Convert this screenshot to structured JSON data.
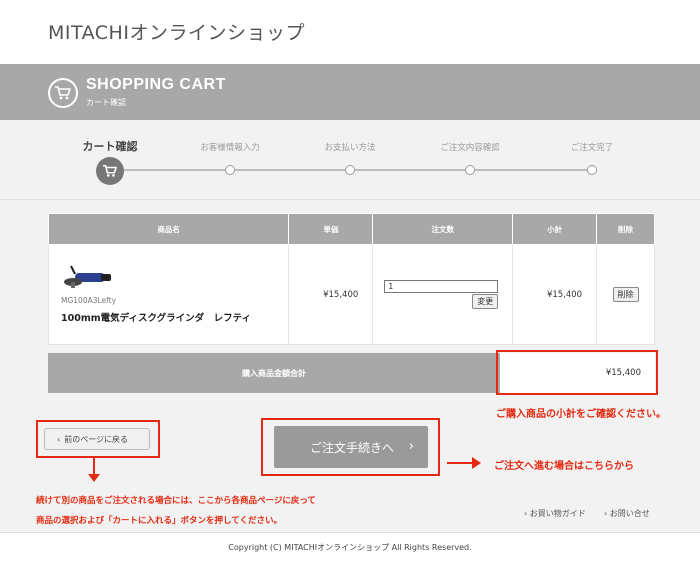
{
  "site": {
    "title": "MITACHIオンラインショップ"
  },
  "cart_header": {
    "title": "SHOPPING CART",
    "subtitle": "カート確認",
    "icon": "shopping-cart-icon"
  },
  "steps": [
    {
      "label": "カート確認",
      "active": true
    },
    {
      "label": "お客様情報入力",
      "active": false
    },
    {
      "label": "お支払い方法",
      "active": false
    },
    {
      "label": "ご注文内容確認",
      "active": false
    },
    {
      "label": "ご注文完了",
      "active": false
    }
  ],
  "table": {
    "headers": {
      "product": "商品名",
      "unit_price": "単価",
      "quantity": "注文数",
      "subtotal": "小計",
      "delete": "削除"
    },
    "rows": [
      {
        "code": "MG100A3Lefty",
        "name": "100mm電気ディスクグラインダ　レフティ",
        "unit_price": "¥15,400",
        "quantity": "1",
        "update_label": "変更",
        "subtotal": "¥15,400",
        "delete_label": "削除"
      }
    ]
  },
  "total": {
    "label": "購入商品金額合計",
    "value": "¥15,400"
  },
  "buttons": {
    "back": "前のページに戻る",
    "back_chevron": "‹",
    "checkout": "ご注文手続きへ",
    "checkout_chevron": "›"
  },
  "annotations": {
    "subtotal_note": "ご購入商品の小計をご確認ください。",
    "checkout_note": "ご注文へ進む場合はこちらから",
    "back_note_line1": "続けて別の商品をご注文される場合には、ここから各商品ページに戻って",
    "back_note_line2": "商品の選択および「カートに入れる」ボタンを押してください。",
    "color": "#e42a12"
  },
  "footer_links": [
    {
      "label": "お買い物ガイド"
    },
    {
      "label": "お問い合せ"
    }
  ],
  "footer": {
    "copyright": "Copyright (C) MITACHIオンラインショップ All Rights Reserved."
  }
}
